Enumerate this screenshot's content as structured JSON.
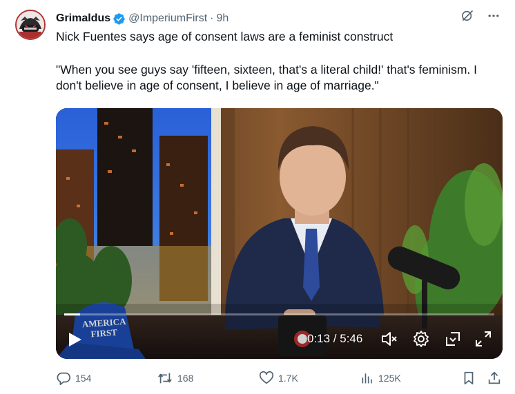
{
  "tweet": {
    "author_name": "Grimaldus",
    "handle": "@ImperiumFirst",
    "separator": "·",
    "time": "9h",
    "text_line1": "Nick Fuentes says age of consent laws are a feminist construct",
    "text_quote": "\"When you see guys say 'fifteen, sixteen, that's a literal child!' that's feminism. I don't believe in age of consent, I believe in age of marriage.\""
  },
  "icons": {
    "avatar": "avatar-icon",
    "verified": "verified-badge-icon",
    "grok": "grok-icon",
    "more": "more-icon",
    "play": "play-icon",
    "mute": "volume-muted-icon",
    "settings": "gear-icon",
    "pip": "picture-in-picture-icon",
    "fullscreen": "fullscreen-icon",
    "reply": "reply-icon",
    "retweet": "retweet-icon",
    "like": "heart-icon",
    "views": "views-icon",
    "bookmark": "bookmark-icon",
    "share": "share-icon"
  },
  "video": {
    "current_time": "0:13",
    "duration": "5:46",
    "time_display": "0:13 / 5:46",
    "progress_fraction": 0.0376,
    "hat_text_line1": "AMERICA",
    "hat_text_line2": "FIRST"
  },
  "stats": {
    "replies": "154",
    "retweets": "168",
    "likes": "1.7K",
    "views": "125K"
  },
  "colors": {
    "accent": "#1d9bf0",
    "text": "#0f1419",
    "secondary": "#536471"
  }
}
